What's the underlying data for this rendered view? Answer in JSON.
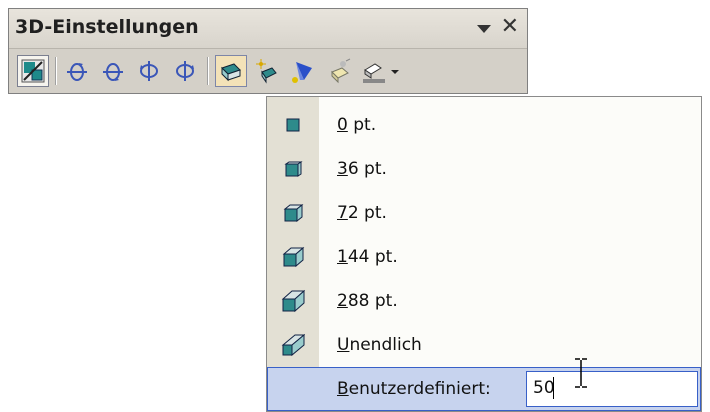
{
  "toolbar": {
    "title": "3D-Einstellungen",
    "buttons": [
      {
        "icon": "toggle-3d-icon",
        "state": "pressed"
      },
      {
        "icon": "tilt-down-icon"
      },
      {
        "icon": "tilt-up-icon"
      },
      {
        "icon": "tilt-left-icon"
      },
      {
        "icon": "tilt-right-icon"
      },
      {
        "icon": "depth-icon",
        "state": "active"
      },
      {
        "icon": "direction-icon"
      },
      {
        "icon": "lighting-icon"
      },
      {
        "icon": "surface-icon"
      },
      {
        "icon": "3d-color-icon"
      }
    ]
  },
  "menu": {
    "items": [
      {
        "prefix": "0",
        "rest": " pt."
      },
      {
        "prefix": "3",
        "rest": "6 pt."
      },
      {
        "prefix": "7",
        "rest": "2 pt."
      },
      {
        "prefix": "1",
        "rest": "44 pt."
      },
      {
        "prefix": "2",
        "rest": "88 pt."
      },
      {
        "prefix": "U",
        "rest": "nendlich"
      }
    ],
    "custom": {
      "prefix": "B",
      "rest": "enutzerdefiniert:",
      "value": "50"
    }
  },
  "colors": {
    "icon_face": "#2e8b8b",
    "icon_side": "#d8e4e4",
    "selection": "#c7d3ee",
    "selection_border": "#3860c8"
  }
}
